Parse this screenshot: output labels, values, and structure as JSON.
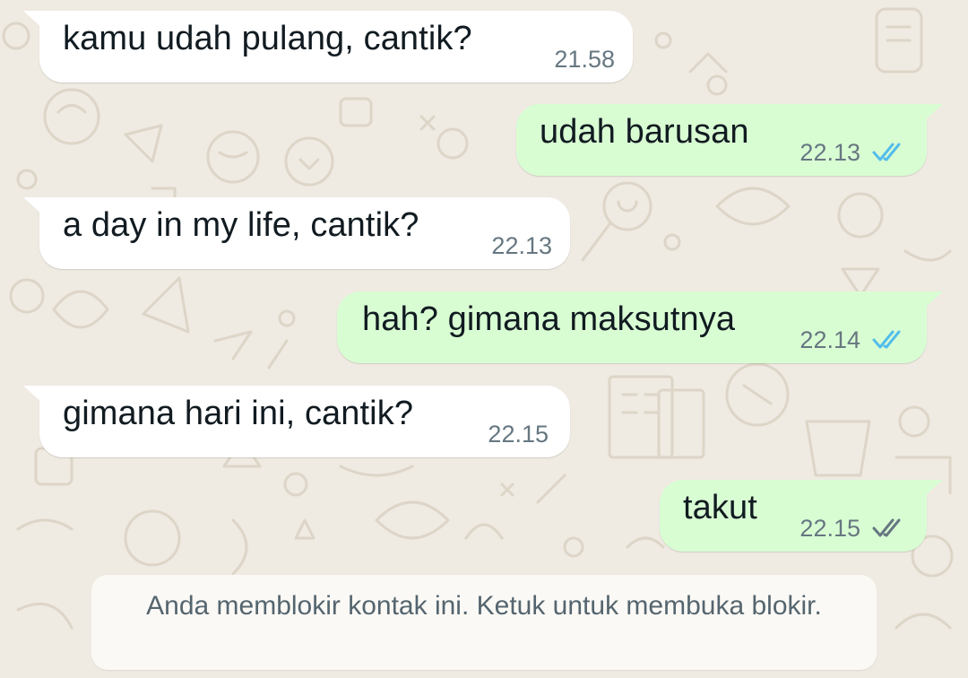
{
  "messages": [
    {
      "direction": "incoming",
      "text": "kamu udah pulang, cantik?",
      "time": "21.58"
    },
    {
      "direction": "outgoing",
      "text": "udah barusan",
      "time": "22.13",
      "status": "read"
    },
    {
      "direction": "incoming",
      "text": "a day in my life, cantik?",
      "time": "22.13"
    },
    {
      "direction": "outgoing",
      "text": "hah? gimana maksutnya",
      "time": "22.14",
      "status": "read"
    },
    {
      "direction": "incoming",
      "text": "gimana hari ini, cantik?",
      "time": "22.15"
    },
    {
      "direction": "outgoing",
      "text": "takut",
      "time": "22.15",
      "status": "delivered"
    }
  ],
  "blocked_notice": "Anda memblokir kontak ini. Ketuk untuk membuka blokir.",
  "colors": {
    "chat_background": "#efeae2",
    "incoming_bubble": "#ffffff",
    "outgoing_bubble": "#d9fdd3",
    "read_tick": "#53bdeb",
    "delivered_tick": "#667781",
    "timestamp": "#667781"
  },
  "icons": {
    "read_status": "double-check-icon",
    "delivered_status": "double-check-icon"
  }
}
